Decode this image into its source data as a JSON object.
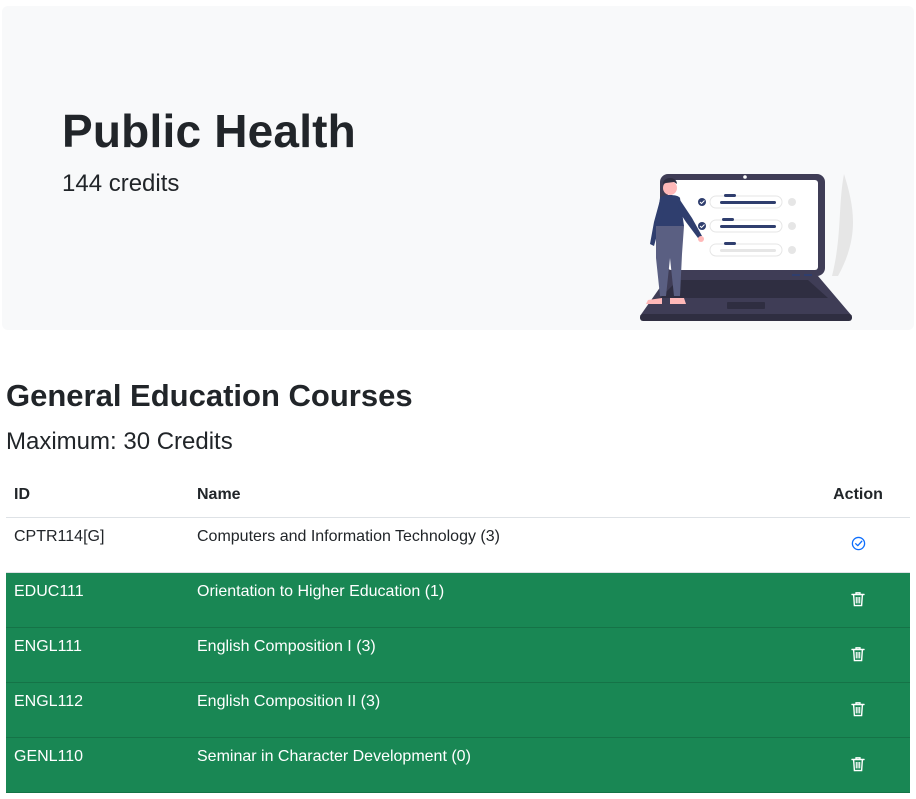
{
  "program": {
    "title": "Public Health",
    "credits": "144 credits"
  },
  "section": {
    "title": "General Education Courses",
    "subtitle": "Maximum: 30 Credits"
  },
  "table": {
    "headers": {
      "id": "ID",
      "name": "Name",
      "action": "Action"
    },
    "rows": [
      {
        "id": "CPTR114[G]",
        "name": "Computers and Information Technology (3)",
        "selected": false,
        "action_icon": "check-circle-icon"
      },
      {
        "id": "EDUC111",
        "name": "Orientation to Higher Education (1)",
        "selected": true,
        "action_icon": "trash-icon"
      },
      {
        "id": "ENGL111",
        "name": "English Composition I (3)",
        "selected": true,
        "action_icon": "trash-icon"
      },
      {
        "id": "ENGL112",
        "name": "English Composition II (3)",
        "selected": true,
        "action_icon": "trash-icon"
      },
      {
        "id": "GENL110",
        "name": "Seminar in Character Development (0)",
        "selected": true,
        "action_icon": "trash-icon"
      }
    ]
  },
  "colors": {
    "selected_row": "#198754",
    "accent_blue": "#0d6efd",
    "hero_bg": "#f8f9fa",
    "illustration_navy": "#3f3d56"
  }
}
